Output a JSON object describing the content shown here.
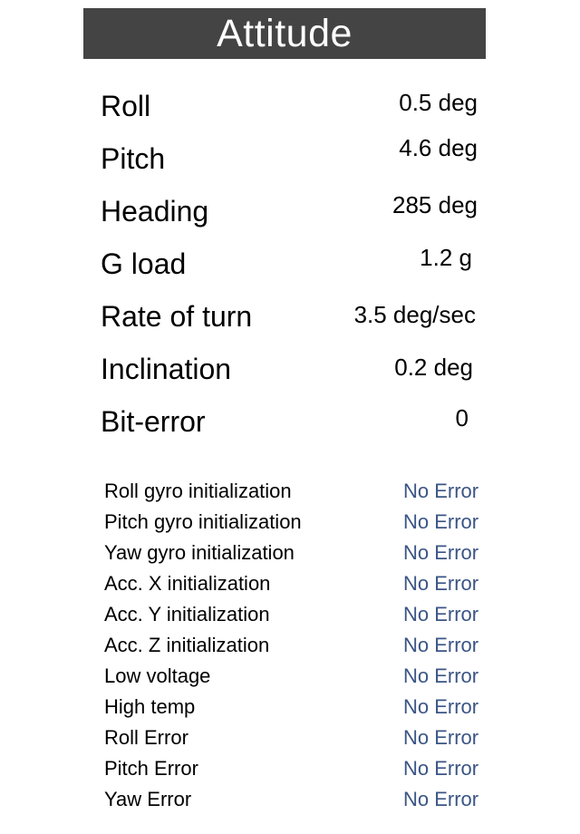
{
  "header": {
    "title": "Attitude"
  },
  "readings": [
    {
      "label": "Roll",
      "value": "0.5 deg"
    },
    {
      "label": "Pitch",
      "value": "4.6 deg"
    },
    {
      "label": "Heading",
      "value": "285 deg"
    },
    {
      "label": "G load",
      "value": "1.2 g"
    },
    {
      "label": "Rate of turn",
      "value": "3.5 deg/sec"
    },
    {
      "label": "Inclination",
      "value": "0.2 deg"
    },
    {
      "label": "Bit-error",
      "value": "0"
    }
  ],
  "status": [
    {
      "label": "Roll gyro initialization",
      "value": "No Error"
    },
    {
      "label": "Pitch gyro initialization",
      "value": "No Error"
    },
    {
      "label": "Yaw gyro initialization",
      "value": "No Error"
    },
    {
      "label": "Acc. X initialization",
      "value": "No Error"
    },
    {
      "label": "Acc. Y initialization",
      "value": "No Error"
    },
    {
      "label": "Acc. Z initialization",
      "value": "No Error"
    },
    {
      "label": "Low voltage",
      "value": "No Error"
    },
    {
      "label": "High temp",
      "value": "No Error"
    },
    {
      "label": "Roll Error",
      "value": "No Error"
    },
    {
      "label": "Pitch Error",
      "value": "No Error"
    },
    {
      "label": "Yaw Error",
      "value": "No Error"
    }
  ],
  "colors": {
    "header_background": "#444444",
    "status_ok": "#3b5585"
  }
}
